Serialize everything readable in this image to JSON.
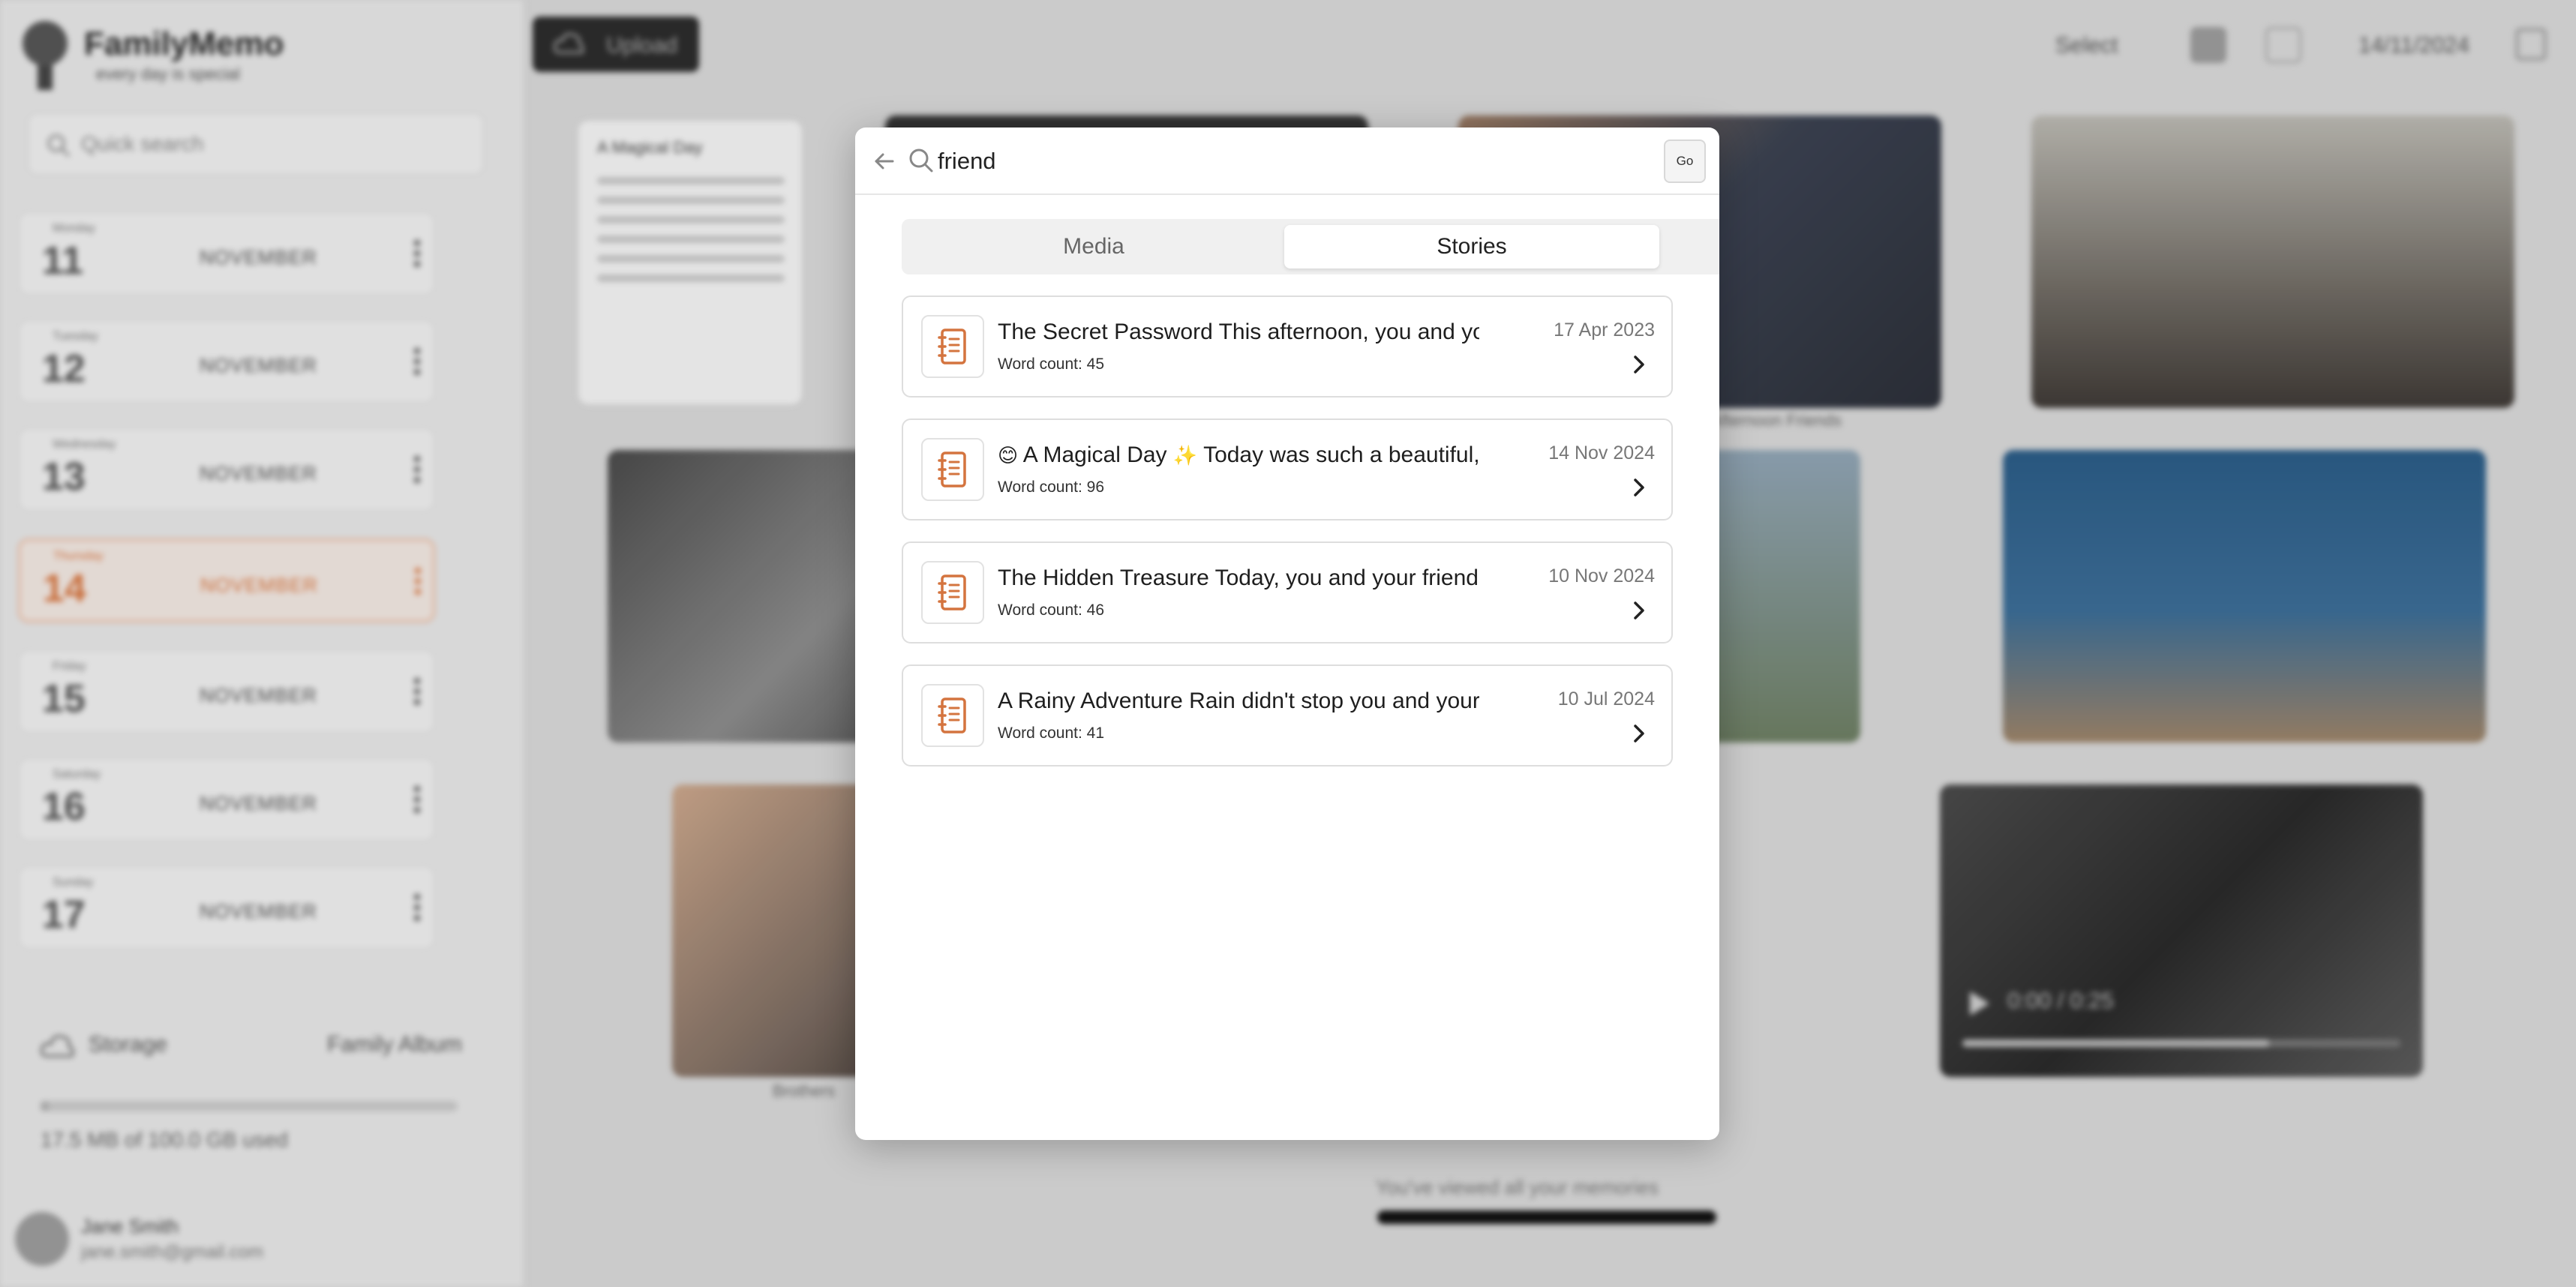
{
  "app": {
    "name": "FamilyMemo",
    "tagline": "every day is special"
  },
  "sidebar": {
    "quick_search_placeholder": "Quick search",
    "days": [
      {
        "weekday": "Monday",
        "number": "11",
        "month": "NOVEMBER",
        "active": false
      },
      {
        "weekday": "Tuesday",
        "number": "12",
        "month": "NOVEMBER",
        "active": false
      },
      {
        "weekday": "Wednesday",
        "number": "13",
        "month": "NOVEMBER",
        "active": false
      },
      {
        "weekday": "Thursday",
        "number": "14",
        "month": "NOVEMBER",
        "active": true
      },
      {
        "weekday": "Friday",
        "number": "15",
        "month": "NOVEMBER",
        "active": false
      },
      {
        "weekday": "Saturday",
        "number": "16",
        "month": "NOVEMBER",
        "active": false
      },
      {
        "weekday": "Sunday",
        "number": "17",
        "month": "NOVEMBER",
        "active": false
      }
    ],
    "storage_label": "Storage",
    "album_label": "Family Album",
    "storage_text": "17.5 MB of 100.0 GB used",
    "storage_fraction": 0.0002,
    "user_name": "Jane Smith",
    "user_email": "jane.smith@gmail.com"
  },
  "topbar": {
    "upload_label": "Upload",
    "select_label": "Select",
    "date_label": "14/11/2024"
  },
  "gallery": {
    "story_tile_title": "A Magical Day",
    "caption_b": "Afternoon Friends",
    "caption_g": "Brothers",
    "video_time": "0:00 / 0:25",
    "video_progress": 0.7,
    "footer_note": "You've viewed all your memories"
  },
  "search": {
    "query": "friend",
    "go_label": "Go",
    "tabs": [
      {
        "label": "Media",
        "active": false
      },
      {
        "label": "Stories",
        "active": true
      }
    ],
    "results": [
      {
        "title": "The Secret Password This afternoon, you and yo",
        "emoji_prefix": "",
        "emoji_mid": "",
        "word_count": "Word count: 45",
        "date": "17 Apr 2023"
      },
      {
        "title_a": "A Magical Day",
        "title_b": "Today was such a beautiful, s",
        "emoji_prefix": "😊",
        "emoji_mid": "✨",
        "word_count": "Word count: 96",
        "date": "14 Nov 2024"
      },
      {
        "title": "The Hidden Treasure Today, you and your friends",
        "emoji_prefix": "",
        "emoji_mid": "",
        "word_count": "Word count: 46",
        "date": "10 Nov 2024"
      },
      {
        "title": "A Rainy Adventure Rain didn't stop you and your f",
        "emoji_prefix": "",
        "emoji_mid": "",
        "word_count": "Word count: 41",
        "date": "10 Jul 2024"
      }
    ]
  },
  "colors": {
    "accent": "#d4743f",
    "modal_bg": "#ffffff",
    "backdrop": "#d6d6d6"
  },
  "icons": {
    "back": "arrow-left-icon",
    "search": "search-icon",
    "story": "notebook-icon",
    "chevron": "chevron-right-icon"
  }
}
